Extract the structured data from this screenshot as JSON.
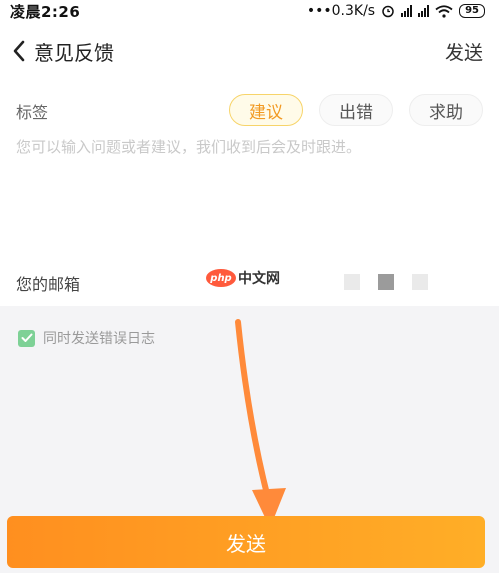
{
  "status_bar": {
    "time": "凌晨2:26",
    "network_speed": "•••0.3K/s",
    "battery": "95",
    "icons": [
      "alarm-icon",
      "signal-hd-icon",
      "signal-hd-icon",
      "wifi-icon",
      "battery-icon"
    ]
  },
  "nav": {
    "title": "意见反馈",
    "send_label": "发送",
    "back_icon": "back-chevron-icon"
  },
  "form": {
    "tag_label": "标签",
    "chips": [
      {
        "label": "建议",
        "active": true
      },
      {
        "label": "出错",
        "active": false
      },
      {
        "label": "求助",
        "active": false
      }
    ],
    "feedback_placeholder": "您可以输入问题或者建议，我们收到后会及时跟进。",
    "email_label": "您的邮箱",
    "send_log_label": "同时发送错误日志",
    "send_log_checked": true
  },
  "watermark": {
    "logo_text": "php",
    "site_text": "中文网"
  },
  "submit": {
    "label": "发送"
  },
  "colors": {
    "accent": "#ff9a22",
    "chip_active_text": "#f29a23",
    "checkbox": "#7ed196"
  }
}
